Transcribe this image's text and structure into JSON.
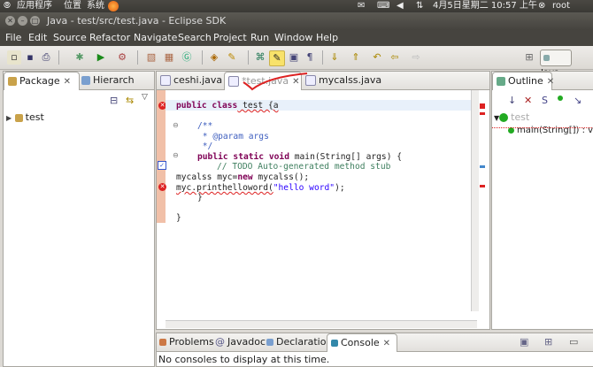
{
  "top_panel": {
    "apps": "应用程序",
    "places": "位置",
    "system": "系统",
    "datetime": "4月5日星期二 10:57 上午",
    "user": "root"
  },
  "window": {
    "title": "Java - test/src/test.java - Eclipse SDK"
  },
  "menu": [
    "File",
    "Edit",
    "Source",
    "Refactor",
    "Navigate",
    "Search",
    "Project",
    "Run",
    "Window",
    "Help"
  ],
  "perspective": {
    "label": "Java"
  },
  "left_view": {
    "tabs": [
      {
        "label": "Package",
        "close": "✕"
      },
      {
        "label": "Hierarch"
      }
    ],
    "tree": [
      {
        "label": "test"
      }
    ]
  },
  "editor": {
    "tabs": [
      {
        "label": "ceshi.java"
      },
      {
        "label": "*test.java",
        "close": "✕"
      },
      {
        "label": "mycalss.java"
      }
    ]
  },
  "code": {
    "l1_kw": "public class",
    "l1_rest": " test {a",
    "l2": "/**",
    "l3": " * @param args",
    "l4": " */",
    "l5_kw": "public static void",
    "l5_rest": " main(String[] args) {",
    "l6": "// TODO Auto-generated method stub",
    "l7_a": "mycalss myc=",
    "l7_kw": "new",
    "l7_b": " mycalss();",
    "l8_a": "myc.printhelloword(",
    "l8_str": "\"hello word\"",
    "l8_b": ");",
    "l9": "}",
    "l10": "}"
  },
  "outline": {
    "title": "Outline",
    "items": [
      {
        "label": "test"
      },
      {
        "label": "main(String[]) : vo"
      }
    ]
  },
  "bottom": {
    "tabs": [
      {
        "label": "Problems"
      },
      {
        "label": "Javadoc"
      },
      {
        "label": "Declaration"
      },
      {
        "label": "Console",
        "close": "✕"
      }
    ],
    "message": "No consoles to display at this time."
  },
  "colors": {
    "accent": "#f07a2d",
    "error": "#d22222",
    "keyword": "#7f0055",
    "comment": "#3f5fbf",
    "string": "#2a00ff"
  }
}
